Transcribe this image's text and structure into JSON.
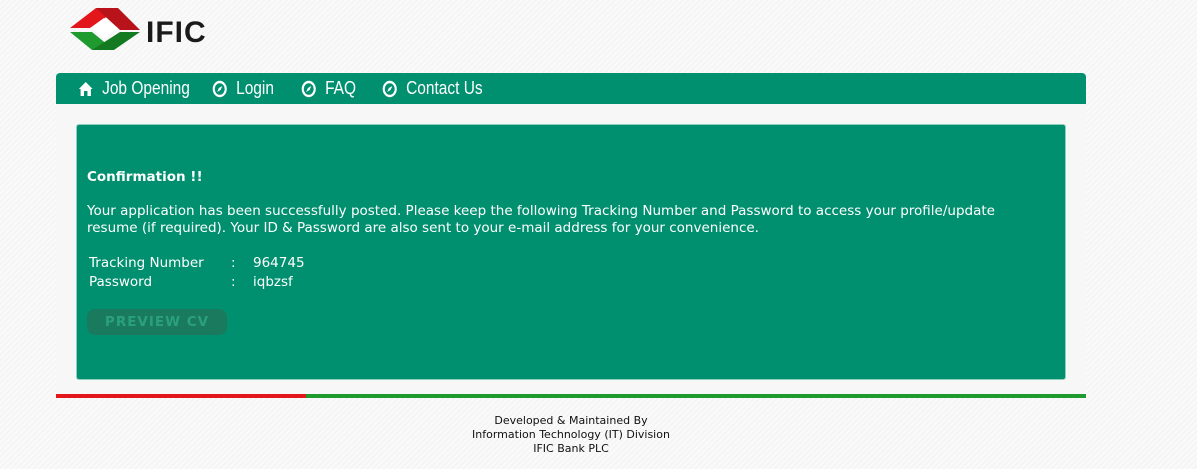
{
  "brand": {
    "logo_text": "IFIC",
    "colors": {
      "red": "#e3161b",
      "green": "#00906f"
    }
  },
  "nav": {
    "items": [
      {
        "label": "Job Opening",
        "icon": "home-icon"
      },
      {
        "label": "Login",
        "icon": "compass-icon"
      },
      {
        "label": "FAQ",
        "icon": "compass-icon"
      },
      {
        "label": "Contact Us",
        "icon": "compass-icon"
      }
    ]
  },
  "confirmation": {
    "heading": "Confirmation !!",
    "message": "Your application has been successfully posted. Please keep the following Tracking Number and Password to access your profile/update resume (if required). Your ID & Password are also sent to your e-mail address for your convenience.",
    "tracking": {
      "label": "Tracking Number",
      "sep": ":",
      "value": "964745"
    },
    "password": {
      "label": "Password",
      "sep": ":",
      "value": "iqbzsf"
    },
    "preview_button": "PREVIEW CV"
  },
  "footer": {
    "line1": "Developed & Maintained By",
    "line2": "Information Technology (IT) Division",
    "line3": "IFIC Bank PLC"
  }
}
